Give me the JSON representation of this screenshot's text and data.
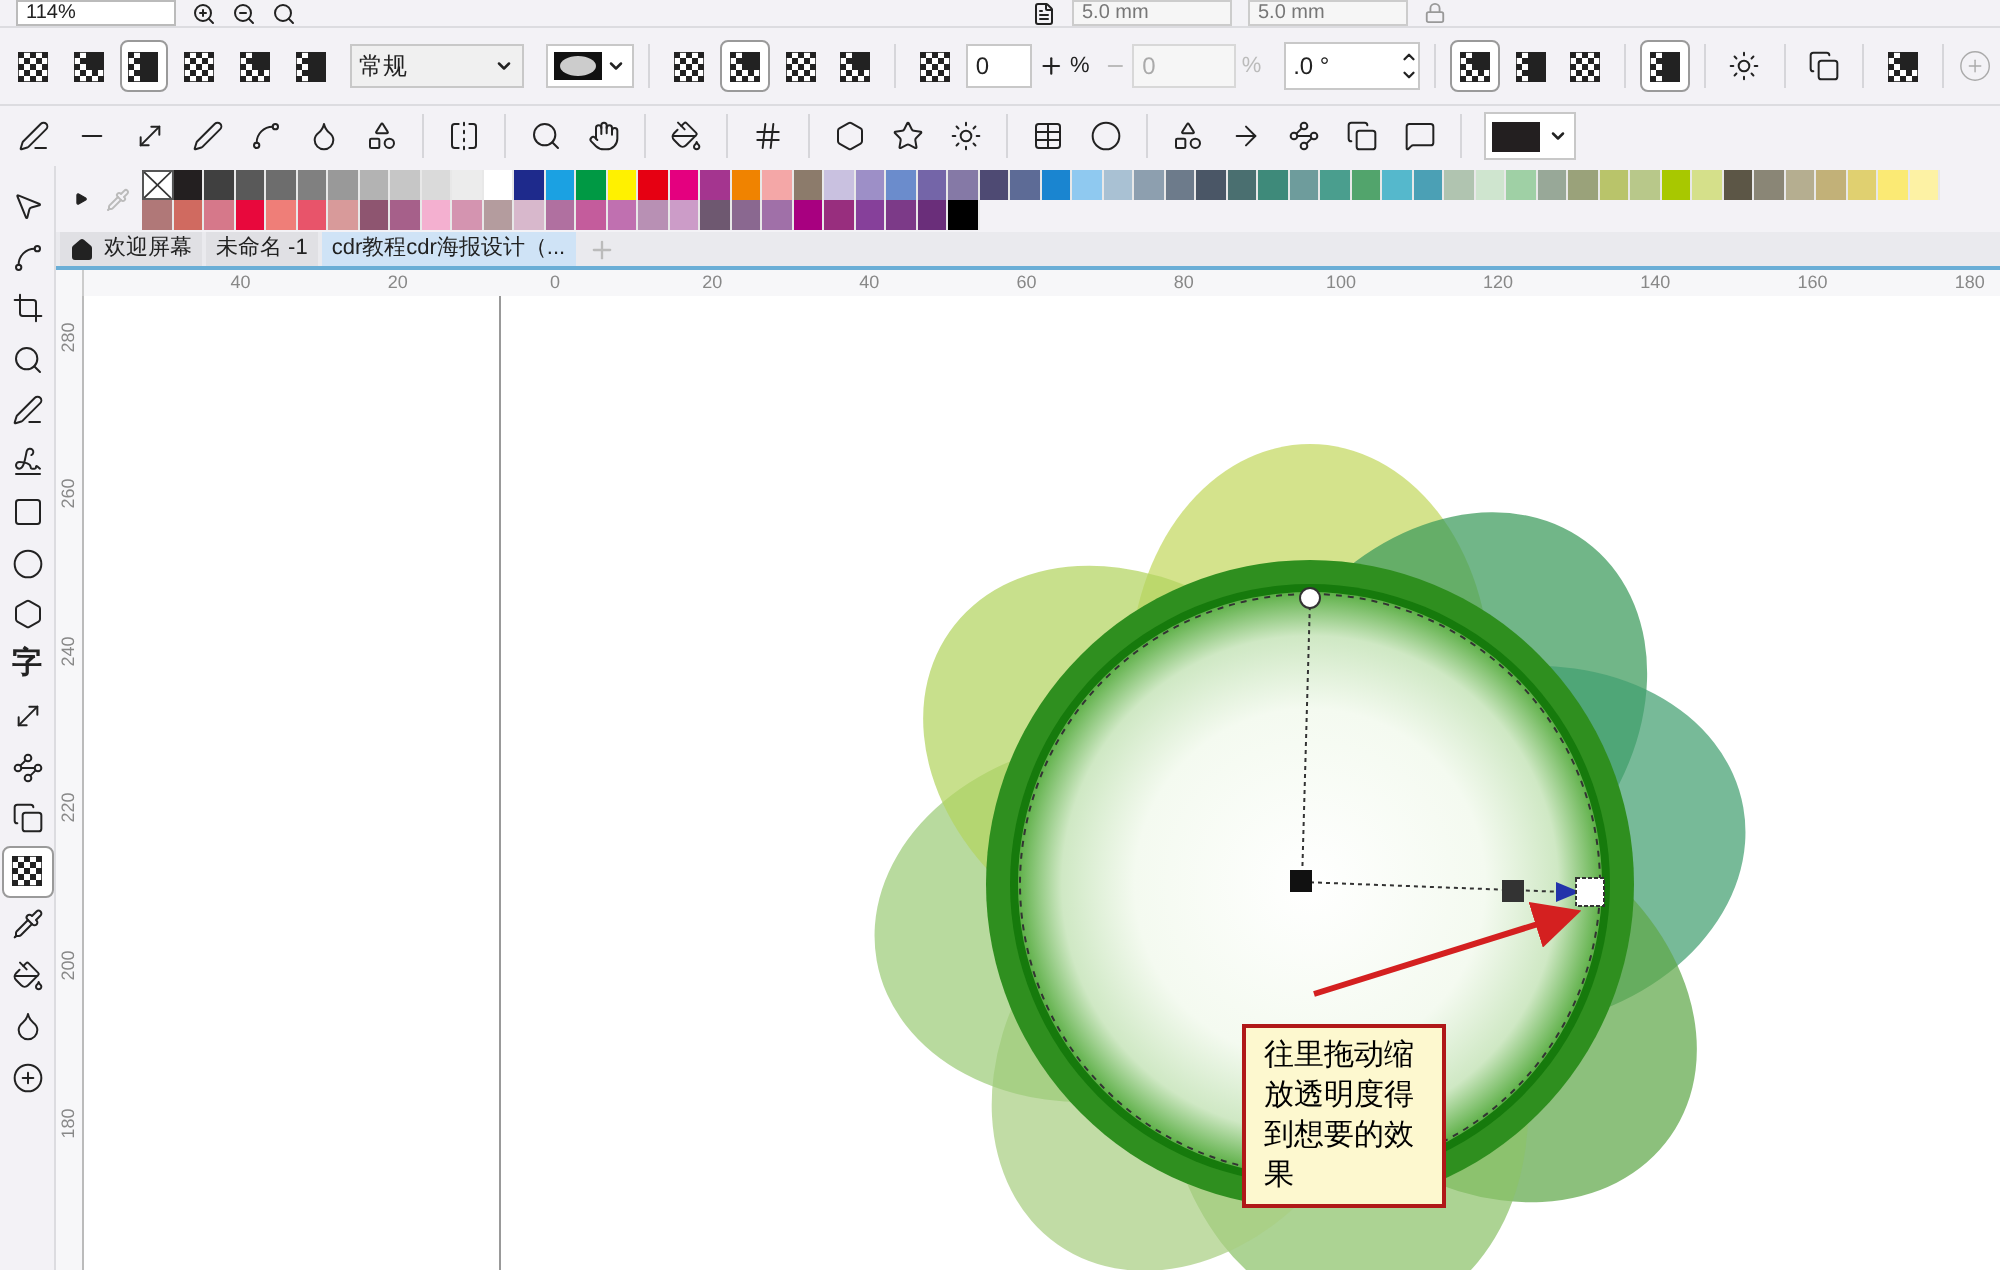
{
  "top_toolbar": {
    "zoom": "114%",
    "fields": [
      "5.0 mm",
      "5.0 mm"
    ]
  },
  "property_bar": {
    "transparency_types": [
      {
        "selected": false
      },
      {
        "selected": false
      },
      {
        "selected": true
      },
      {
        "selected": false
      },
      {
        "selected": false
      },
      {
        "selected": false
      }
    ],
    "merge_mode": "常规",
    "merge_targets": [
      {
        "selected": false
      },
      {
        "selected": true
      },
      {
        "selected": false
      },
      {
        "selected": false
      }
    ],
    "opacity": "0",
    "opacity_unit": "%",
    "feather": "0",
    "feather_unit": "%",
    "angle": ".0 °",
    "apply_modes": [
      {
        "selected": true
      },
      {
        "selected": false
      },
      {
        "selected": false
      }
    ],
    "freeze": {
      "selected": true
    }
  },
  "palette": {
    "row_1": [
      {
        "kind": "none",
        "color": "#ffffff"
      },
      {
        "kind": "color",
        "color": "#231f20"
      },
      {
        "kind": "color",
        "color": "#404040"
      },
      {
        "kind": "color",
        "color": "#595959"
      },
      {
        "kind": "color",
        "color": "#6d6d6d"
      },
      {
        "kind": "color",
        "color": "#808080"
      },
      {
        "kind": "color",
        "color": "#999999"
      },
      {
        "kind": "color",
        "color": "#b3b3b3"
      },
      {
        "kind": "color",
        "color": "#c6c6c6"
      },
      {
        "kind": "color",
        "color": "#dadada"
      },
      {
        "kind": "color",
        "color": "#ececec"
      },
      {
        "kind": "color",
        "color": "#ffffff"
      },
      {
        "kind": "color",
        "color": "#1e2a8c"
      },
      {
        "kind": "color",
        "color": "#1ba1e2"
      },
      {
        "kind": "color",
        "color": "#009944"
      },
      {
        "kind": "color",
        "color": "#fff100"
      },
      {
        "kind": "color",
        "color": "#e60012"
      },
      {
        "kind": "color",
        "color": "#e4007f"
      },
      {
        "kind": "color",
        "color": "#a4358f"
      },
      {
        "kind": "color",
        "color": "#f08300"
      },
      {
        "kind": "color",
        "color": "#f4a7a7"
      },
      {
        "kind": "color",
        "color": "#8c7b6b"
      },
      {
        "kind": "color",
        "color": "#c9c1e0"
      },
      {
        "kind": "color",
        "color": "#9d8fc7"
      },
      {
        "kind": "color",
        "color": "#6b8ccc"
      },
      {
        "kind": "color",
        "color": "#7465a8"
      },
      {
        "kind": "color",
        "color": "#8579a6"
      },
      {
        "kind": "color",
        "color": "#4e4a73"
      },
      {
        "kind": "color",
        "color": "#5d6b96"
      },
      {
        "kind": "color",
        "color": "#1a85d0"
      },
      {
        "kind": "color",
        "color": "#8fc9f0"
      },
      {
        "kind": "color",
        "color": "#a9c1d3"
      },
      {
        "kind": "color",
        "color": "#8d9faf"
      },
      {
        "kind": "color",
        "color": "#6d7b8b"
      },
      {
        "kind": "color",
        "color": "#4a5666"
      },
      {
        "kind": "color",
        "color": "#4a6f70"
      },
      {
        "kind": "color",
        "color": "#3e8a7a"
      },
      {
        "kind": "color",
        "color": "#6e9c9c"
      },
      {
        "kind": "color",
        "color": "#4a9e8e"
      },
      {
        "kind": "color",
        "color": "#52a46c"
      },
      {
        "kind": "color",
        "color": "#55b8cc"
      },
      {
        "kind": "color",
        "color": "#4ba0b5"
      },
      {
        "kind": "color",
        "color": "#b0c4b0"
      },
      {
        "kind": "color",
        "color": "#cfe5cf"
      },
      {
        "kind": "color",
        "color": "#9fd0a5"
      },
      {
        "kind": "color",
        "color": "#98a898"
      },
      {
        "kind": "color",
        "color": "#9aa27a"
      },
      {
        "kind": "color",
        "color": "#b9c46a"
      },
      {
        "kind": "color",
        "color": "#b8c88a"
      },
      {
        "kind": "color",
        "color": "#a8c800"
      },
      {
        "kind": "color",
        "color": "#d5e08a"
      },
      {
        "kind": "color",
        "color": "#5c5646"
      },
      {
        "kind": "color",
        "color": "#8a8676"
      },
      {
        "kind": "color",
        "color": "#b5ae90"
      },
      {
        "kind": "color",
        "color": "#c2b178"
      },
      {
        "kind": "color",
        "color": "#e0d070"
      },
      {
        "kind": "color",
        "color": "#fbea74"
      },
      {
        "kind": "color",
        "color": "#fdf2a4"
      }
    ],
    "row_2": [
      {
        "kind": "color",
        "color": "#b07878"
      },
      {
        "kind": "color",
        "color": "#d06a60"
      },
      {
        "kind": "color",
        "color": "#d6788a"
      },
      {
        "kind": "color",
        "color": "#e8083c"
      },
      {
        "kind": "color",
        "color": "#ef7e78"
      },
      {
        "kind": "color",
        "color": "#e8546a"
      },
      {
        "kind": "color",
        "color": "#d89a9a"
      },
      {
        "kind": "color",
        "color": "#8e5570"
      },
      {
        "kind": "color",
        "color": "#a6608a"
      },
      {
        "kind": "color",
        "color": "#f4b0d0"
      },
      {
        "kind": "color",
        "color": "#d494b0"
      },
      {
        "kind": "color",
        "color": "#b49c9e"
      },
      {
        "kind": "color",
        "color": "#d8b8cc"
      },
      {
        "kind": "color",
        "color": "#b070a0"
      },
      {
        "kind": "color",
        "color": "#c45c9c"
      },
      {
        "kind": "color",
        "color": "#c070b0"
      },
      {
        "kind": "color",
        "color": "#b890b4"
      },
      {
        "kind": "color",
        "color": "#cc9cc8"
      },
      {
        "kind": "color",
        "color": "#6e5870"
      },
      {
        "kind": "color",
        "color": "#8a6890"
      },
      {
        "kind": "color",
        "color": "#a070a8"
      },
      {
        "kind": "color",
        "color": "#a80080"
      },
      {
        "kind": "color",
        "color": "#982e7e"
      },
      {
        "kind": "color",
        "color": "#86409a"
      },
      {
        "kind": "color",
        "color": "#7c3a88"
      },
      {
        "kind": "color",
        "color": "#6a2e7a"
      },
      {
        "kind": "color",
        "color": "#000000"
      }
    ]
  },
  "toolbox": [
    {
      "kind": "pick",
      "selected": false
    },
    {
      "kind": "shape",
      "selected": false
    },
    {
      "kind": "crop",
      "selected": false
    },
    {
      "kind": "zoom",
      "selected": false
    },
    {
      "kind": "freehand",
      "selected": false
    },
    {
      "kind": "artistic",
      "selected": false
    },
    {
      "kind": "rectangle",
      "selected": false
    },
    {
      "kind": "ellipse",
      "selected": false
    },
    {
      "kind": "polygon",
      "selected": false
    },
    {
      "kind": "text",
      "label": "字",
      "selected": false
    },
    {
      "kind": "dimension",
      "selected": false
    },
    {
      "kind": "connector",
      "selected": false
    },
    {
      "kind": "shadow",
      "selected": false
    },
    {
      "kind": "transparency",
      "selected": true
    },
    {
      "kind": "eyedropper",
      "selected": false
    },
    {
      "kind": "fill",
      "selected": false
    },
    {
      "kind": "outline",
      "selected": false
    },
    {
      "kind": "add",
      "selected": false
    }
  ],
  "document_tabs": [
    {
      "kind": "home",
      "label": "欢迎屏幕",
      "selected": false
    },
    {
      "kind": "document",
      "label": "未命名 -1",
      "selected": false
    },
    {
      "kind": "document",
      "label": "cdr教程cdr海报设计（...",
      "selected": true
    }
  ],
  "horizontal_ruler": [
    "40",
    "20",
    "0",
    "20",
    "40",
    "60",
    "80",
    "100",
    "120",
    "140",
    "160",
    "180"
  ],
  "vertical_ruler": [
    "280",
    "260",
    "240",
    "220",
    "200",
    "180"
  ],
  "annotation": "往里拖动缩放透明度得到想要的效果"
}
